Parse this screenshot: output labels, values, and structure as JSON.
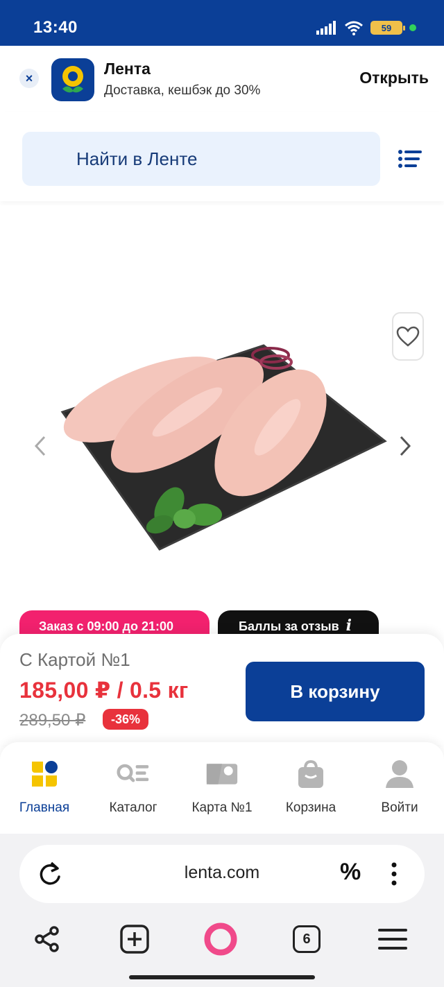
{
  "status_bar": {
    "time": "13:40",
    "battery": "59"
  },
  "app_banner": {
    "close": "×",
    "name": "Лента",
    "subtitle": "Доставка, кешбэк до 30%",
    "open_label": "Открыть"
  },
  "search": {
    "placeholder": "Найти в Ленте"
  },
  "badges": {
    "order_hours": "Заказ с 09:00 до 21:00",
    "review_points": "Баллы за отзыв",
    "info": "i"
  },
  "price": {
    "label": "С Картой №1",
    "current": "185,00 ₽ / 0.5 кг",
    "old": "289,50 ₽",
    "discount": "-36%",
    "cart_button": "В корзину"
  },
  "bottom_nav": {
    "items": [
      {
        "label": "Главная",
        "icon": "home-icon",
        "active": true
      },
      {
        "label": "Каталог",
        "icon": "catalog-icon",
        "active": false
      },
      {
        "label": "Карта №1",
        "icon": "loyalty-card-icon",
        "active": false
      },
      {
        "label": "Корзина",
        "icon": "cart-icon",
        "active": false
      },
      {
        "label": "Войти",
        "icon": "user-icon",
        "active": false
      }
    ]
  },
  "browser": {
    "url": "lenta.com",
    "tabs_count": "6",
    "promo_symbol": "%"
  },
  "colors": {
    "brand_blue": "#0b3f97",
    "accent_red": "#e8323c",
    "badge_pink": "#f2216e"
  }
}
